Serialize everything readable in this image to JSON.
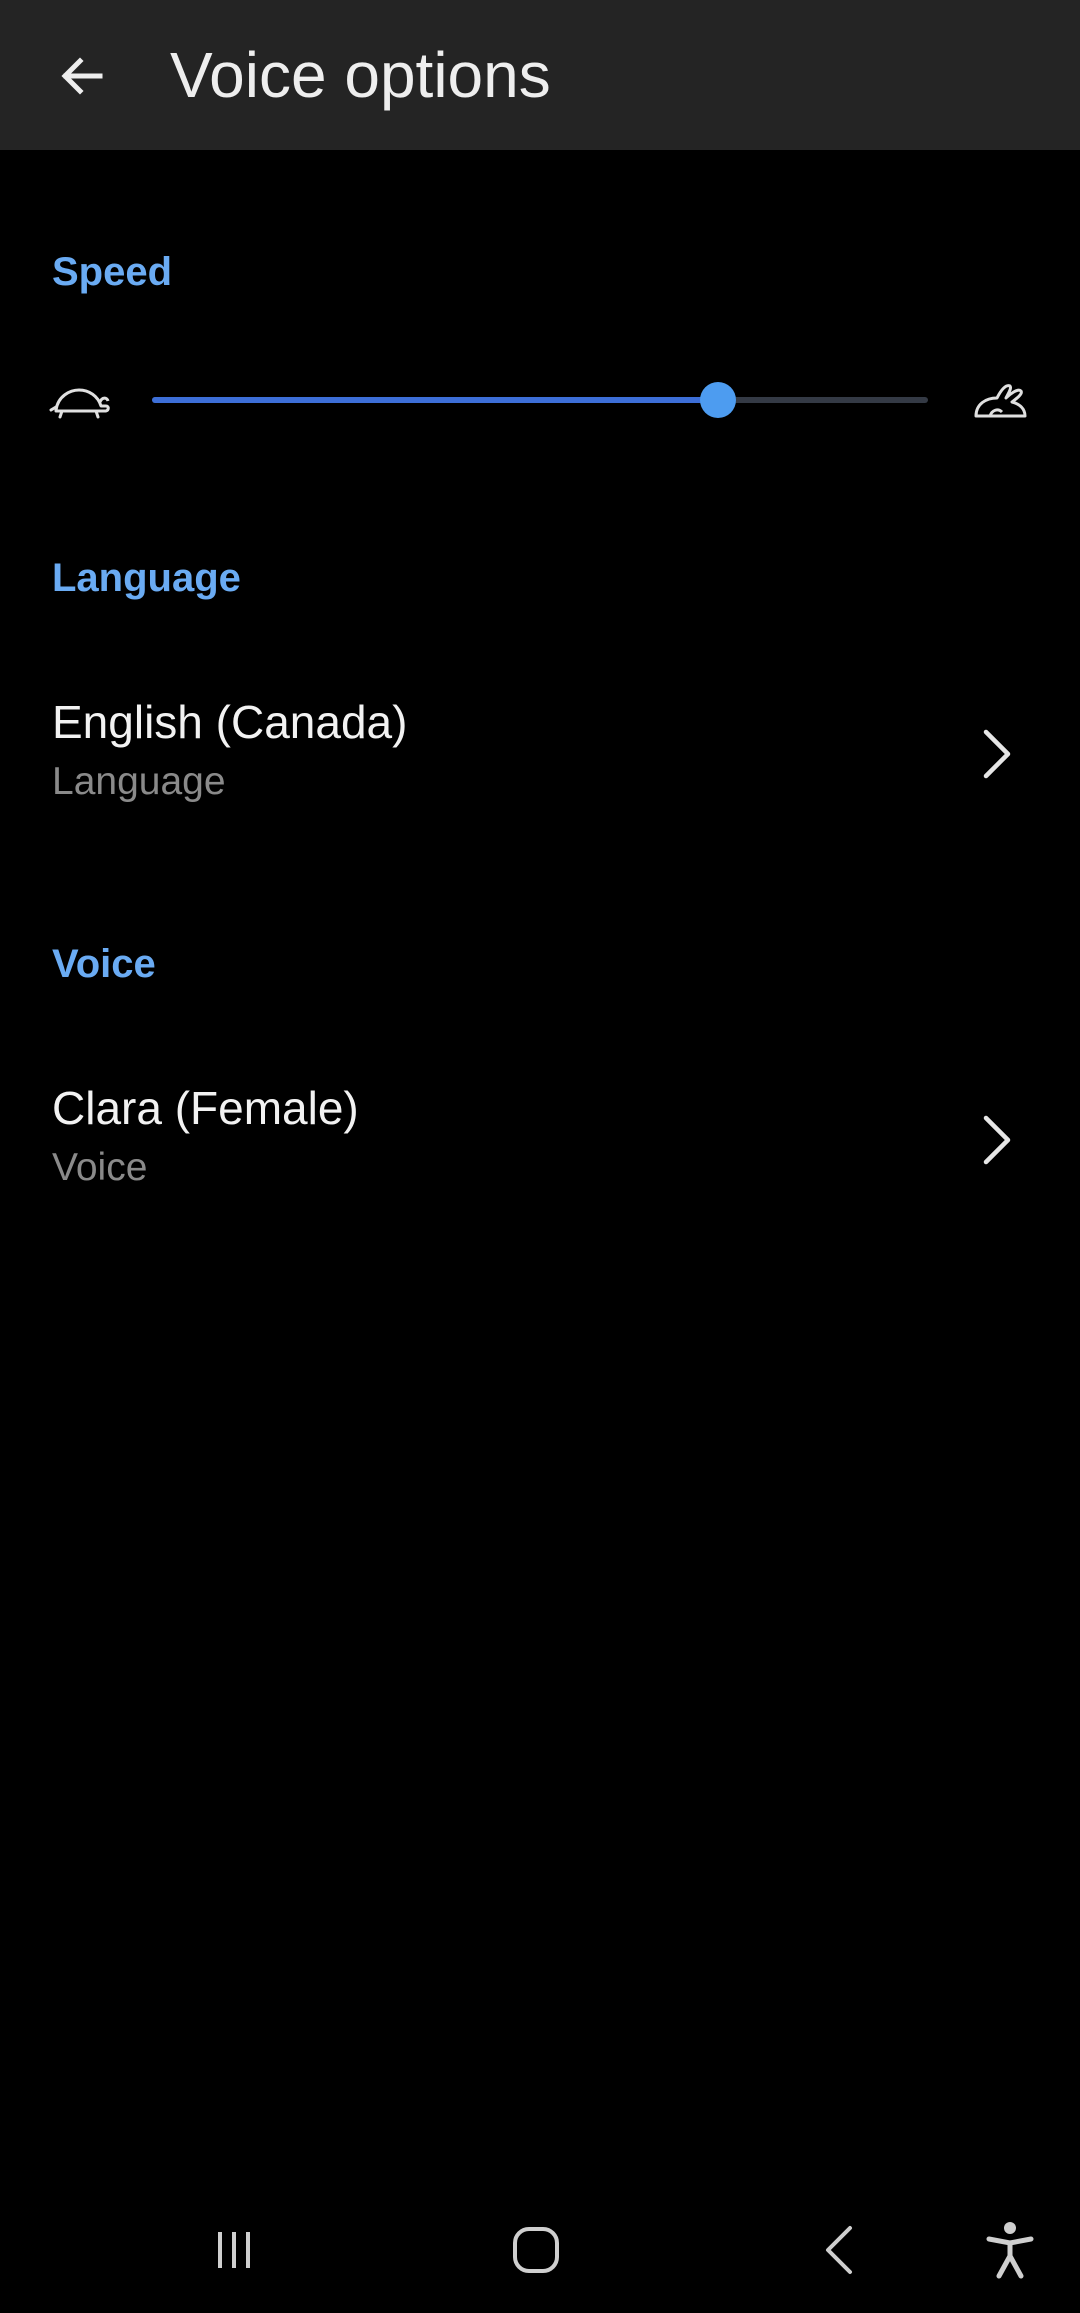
{
  "app_bar": {
    "title": "Voice options",
    "back_icon": "arrow-left-icon"
  },
  "speed": {
    "header": "Speed",
    "slow_icon": "turtle-icon",
    "fast_icon": "rabbit-icon",
    "value_fraction": 0.73
  },
  "language": {
    "header": "Language",
    "value": "English (Canada)",
    "label": "Language"
  },
  "voice": {
    "header": "Voice",
    "value": "Clara (Female)",
    "label": "Voice"
  },
  "nav_bar": {
    "icons": [
      "recent-apps-icon",
      "home-icon",
      "back-icon",
      "accessibility-icon"
    ]
  },
  "colors": {
    "accent": "#6aabf3",
    "slider_fill": "#3d6fd8",
    "slider_thumb": "#4d9cf0",
    "app_bar_bg": "#242424",
    "background": "#000000",
    "secondary_text": "#8a8a8a"
  }
}
